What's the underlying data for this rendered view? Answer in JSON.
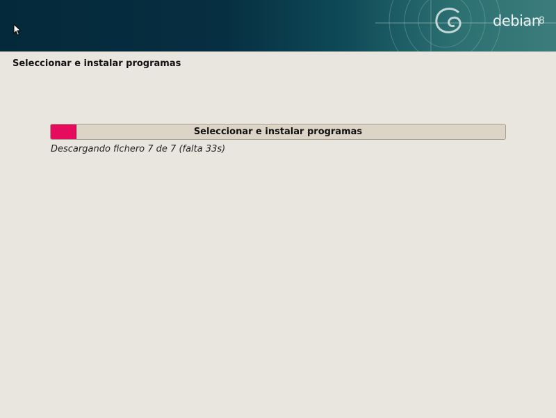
{
  "banner": {
    "logo_text": "debian",
    "logo_version": "8",
    "logo_icon": "debian-swirl-icon"
  },
  "installer": {
    "step_title": "Seleccionar e instalar programas",
    "progress": {
      "label": "Seleccionar e instalar programas",
      "fraction": 0.055,
      "fill_color": "#e60b5c"
    },
    "status_text": "Descargando fichero 7 de 7 (falta 33s)"
  },
  "colors": {
    "background": "#e8e6df",
    "banner_dark": "#04293a",
    "banner_light": "#3c7d7c",
    "progress_track": "#dcd4c6"
  }
}
